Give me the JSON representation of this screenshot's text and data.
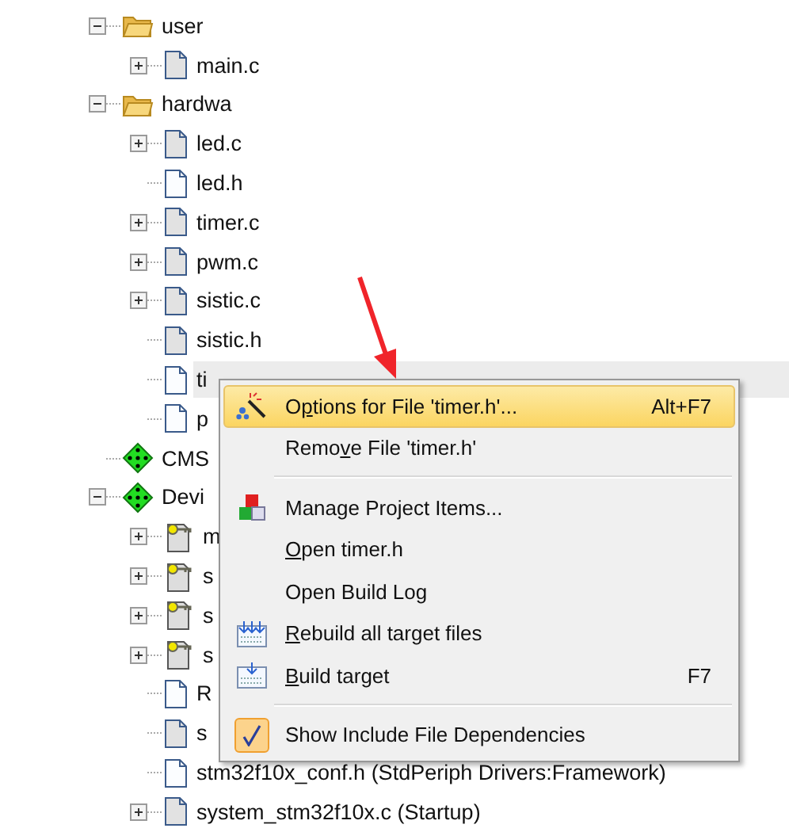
{
  "tree": [
    {
      "label": "user",
      "kind": "folder",
      "expanded": true,
      "selected": false,
      "children": [
        {
          "label": "main.c",
          "kind": "source",
          "expanded": false,
          "selected": false
        }
      ]
    },
    {
      "label": "hardwa",
      "kind": "folder",
      "expanded": true,
      "selected": false,
      "children": [
        {
          "label": "led.c",
          "kind": "source",
          "expanded": false,
          "selected": false
        },
        {
          "label": "led.h",
          "kind": "header",
          "selected": false
        },
        {
          "label": "timer.c",
          "kind": "source",
          "expanded": false,
          "selected": false
        },
        {
          "label": "pwm.c",
          "kind": "source",
          "expanded": false,
          "selected": false
        },
        {
          "label": "sistic.c",
          "kind": "source",
          "expanded": false,
          "selected": false
        },
        {
          "label": "sistic.h",
          "kind": "source",
          "selected": false
        },
        {
          "label": "ti",
          "kind": "header",
          "selected": true
        },
        {
          "label": "p",
          "kind": "header",
          "selected": false
        }
      ]
    },
    {
      "label": "CMS",
      "kind": "component",
      "selected": false
    },
    {
      "label": "Devi",
      "kind": "component",
      "expanded": true,
      "selected": false,
      "children": [
        {
          "label": "m",
          "kind": "locked",
          "expanded": false,
          "selected": false
        },
        {
          "label": "s",
          "kind": "locked",
          "expanded": false,
          "selected": false
        },
        {
          "label": "s",
          "kind": "locked",
          "expanded": false,
          "selected": false
        },
        {
          "label": "s",
          "kind": "locked",
          "expanded": false,
          "selected": false
        },
        {
          "label": "R",
          "kind": "header",
          "selected": false
        },
        {
          "label": "s",
          "kind": "source",
          "selected": false
        },
        {
          "label": "stm32f10x_conf.h (StdPeriph Drivers:Framework)",
          "kind": "header",
          "selected": false
        },
        {
          "label": "system_stm32f10x.c (Startup)",
          "kind": "source",
          "expanded": false,
          "selected": false
        }
      ]
    }
  ],
  "context_menu": [
    {
      "kind": "item",
      "pre": "O",
      "key": "p",
      "post": "tions for File 'timer.h'...",
      "shortcut": "Alt+F7",
      "highlighted": true,
      "checked": false
    },
    {
      "kind": "item",
      "pre": "Remo",
      "key": "v",
      "post": "e File 'timer.h'",
      "highlighted": false,
      "checked": false
    },
    {
      "kind": "separator"
    },
    {
      "kind": "item",
      "post": "Manage Project Items...",
      "highlighted": false,
      "checked": false
    },
    {
      "kind": "item",
      "key": "O",
      "post": "pen timer.h",
      "highlighted": false,
      "checked": false
    },
    {
      "kind": "item",
      "post": "Open Build Log",
      "highlighted": false,
      "checked": false
    },
    {
      "kind": "item",
      "key": "R",
      "post": "ebuild all target files",
      "highlighted": false,
      "checked": false
    },
    {
      "kind": "item",
      "key": "B",
      "post": "uild target",
      "shortcut": "F7",
      "highlighted": false,
      "checked": false
    },
    {
      "kind": "separator"
    },
    {
      "kind": "item",
      "post": "Show Include File Dependencies",
      "highlighted": false,
      "checked": true
    }
  ]
}
